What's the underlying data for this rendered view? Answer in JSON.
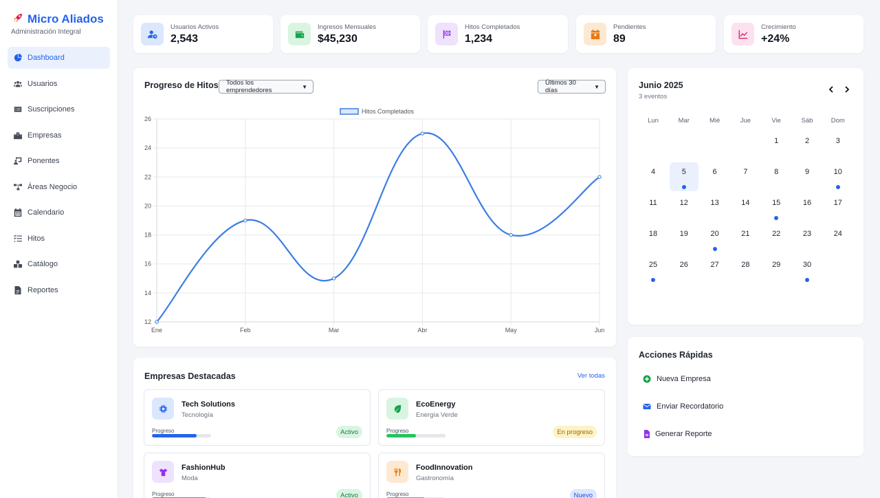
{
  "brand": {
    "title": "Micro Aliados",
    "subtitle": "Administración Integral",
    "icon": "rocket-icon"
  },
  "sidebar": {
    "items": [
      {
        "label": "Dashboard",
        "icon": "dashboard-icon",
        "active": true
      },
      {
        "label": "Usuarios",
        "icon": "users-icon"
      },
      {
        "label": "Suscripciones",
        "icon": "card-icon"
      },
      {
        "label": "Empresas",
        "icon": "building-icon"
      },
      {
        "label": "Ponentes",
        "icon": "presenter-icon"
      },
      {
        "label": "Áreas Negocio",
        "icon": "sitemap-icon"
      },
      {
        "label": "Calendario",
        "icon": "calendar-icon"
      },
      {
        "label": "Hitos",
        "icon": "list-check-icon"
      },
      {
        "label": "Catálogo",
        "icon": "boxes-icon"
      },
      {
        "label": "Reportes",
        "icon": "file-icon"
      }
    ]
  },
  "stats": [
    {
      "label": "Usuarios Activos",
      "value": "2,543",
      "icon": "user-clock-icon",
      "color": "#2563eb",
      "bg": "#dbe7fd"
    },
    {
      "label": "Ingresos Mensuales",
      "value": "$45,230",
      "icon": "wallet-icon",
      "color": "#16a34a",
      "bg": "#d9f5e2"
    },
    {
      "label": "Hitos Completados",
      "value": "1,234",
      "icon": "flag-icon",
      "color": "#9333ea",
      "bg": "#efe2fc"
    },
    {
      "label": "Pendientes",
      "value": "89",
      "icon": "calendar-x-icon",
      "color": "#ea7a12",
      "bg": "#fde9d2"
    },
    {
      "label": "Crecimiento",
      "value": "+24%",
      "icon": "chart-line-icon",
      "color": "#db2777",
      "bg": "#fce1ee"
    }
  ],
  "progress": {
    "title": "Progreso de Hitos",
    "filter": "Todos los emprendedores",
    "range": "Últimos 30 días"
  },
  "chart_data": {
    "type": "line",
    "categories": [
      "Ene",
      "Feb",
      "Mar",
      "Abr",
      "May",
      "Jun"
    ],
    "series": [
      {
        "name": "Hitos Completados",
        "values": [
          12,
          19,
          15,
          25,
          18,
          22
        ],
        "color": "#3b7de3"
      }
    ],
    "ylim": [
      12,
      26
    ],
    "yticks": [
      12,
      14,
      16,
      18,
      20,
      22,
      24,
      26
    ],
    "grid": true,
    "legend": "top-center"
  },
  "calendar": {
    "title": "Junio 2025",
    "subtitle": "3 eventos",
    "weekdays": [
      "Lun",
      "Mar",
      "Mié",
      "Jue",
      "Vie",
      "Sáb",
      "Dom"
    ],
    "first_weekday_index": 4,
    "days_in_month": 30,
    "today": 5,
    "event_days": [
      5,
      10,
      15,
      20,
      25,
      30
    ]
  },
  "quick_actions": {
    "title": "Acciones Rápidas",
    "items": [
      {
        "label": "Nueva Empresa",
        "icon": "plus-circle-icon",
        "color": "#16a34a"
      },
      {
        "label": "Enviar Recordatorio",
        "icon": "envelope-icon",
        "color": "#2563eb"
      },
      {
        "label": "Generar Reporte",
        "icon": "file-report-icon",
        "color": "#9333ea"
      }
    ]
  },
  "empresas": {
    "title": "Empresas Destacadas",
    "link": "Ver todas",
    "progress_label": "Progreso",
    "items": [
      {
        "name": "Tech Solutions",
        "category": "Tecnología",
        "progress": 0.75,
        "status": "Activo",
        "icon": "chip-icon",
        "color": "#2563eb",
        "bg": "#dbe7fd",
        "bar": "#2563eb",
        "badge_bg": "#d9f5e2",
        "badge_fg": "#15803d"
      },
      {
        "name": "EcoEnergy",
        "category": "Energía Verde",
        "progress": 0.5,
        "status": "En progreso",
        "icon": "leaf-icon",
        "color": "#16a34a",
        "bg": "#d9f5e2",
        "bar": "#22c55e",
        "badge_bg": "#fdf3c4",
        "badge_fg": "#a16207"
      },
      {
        "name": "FashionHub",
        "category": "Moda",
        "progress": 0.92,
        "status": "Activo",
        "icon": "shirt-icon",
        "color": "#9333ea",
        "bg": "#efe2fc",
        "bar": "#a855f7",
        "badge_bg": "#d9f5e2",
        "badge_fg": "#15803d"
      },
      {
        "name": "FoodInnovation",
        "category": "Gastronomía",
        "progress": 0.65,
        "status": "Nuevo",
        "icon": "utensils-icon",
        "color": "#ea7a12",
        "bg": "#fde9d2",
        "bar": "#f97316",
        "badge_bg": "#dbe7fd",
        "badge_fg": "#1d4ed8"
      }
    ]
  }
}
